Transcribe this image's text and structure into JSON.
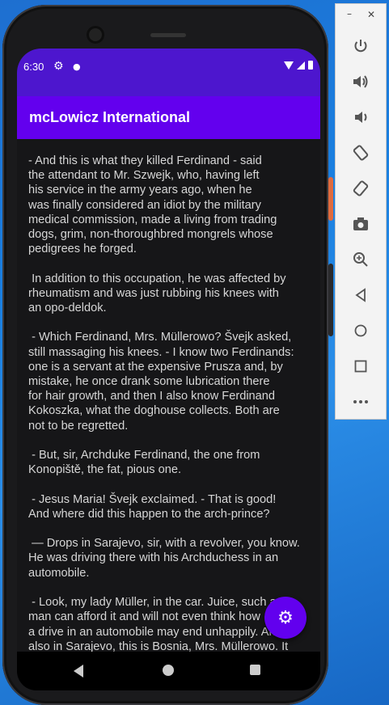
{
  "status_bar": {
    "time": "6:30"
  },
  "app_bar": {
    "title": "mcLowicz International"
  },
  "content": {
    "text": "- And this is what they killed Ferdinand - said\nthe attendant to Mr. Szwejk, who, having left\nhis service in the army years ago, when he\nwas finally considered an idiot by the military\nmedical commission, made a living from trading\ndogs, grim, non-thoroughbred mongrels whose\npedigrees he forged.\n\n In addition to this occupation, he was affected by\nrheumatism and was just rubbing his knees with\nan opo-deldok.\n\n - Which Ferdinand, Mrs. Müllerowo? Švejk asked,\nstill massaging his knees. - I know two Ferdinands:\none is a servant at the expensive Prusza and, by\nmistake, he once drank some lubrication there\nfor hair growth, and then I also know Ferdinand\nKokoszka, what the doghouse collects. Both are\nnot to be regretted.\n\n - But, sir, Archduke Ferdinand, the one from\nKonopiště, the fat, pious one.\n\n - Jesus Maria! Švejk exclaimed. - That is good!\nAnd where did this happen to the arch-prince?\n\n — Drops in Sarajevo, sir, with a revolver, you know.\nHe was driving there with his Archduchess in an\nautomobile.\n\n - Look, my lady Müller, in the car. Juice, such a\nman can afford it and will not even think how\na drive in an automobile may end unhappily. And\nalso in Sarajevo, this is Bosnia, Mrs. Müllerowo. It"
  },
  "icons": {
    "status_settings": "gear-icon",
    "fab": "settings-gear-icon",
    "panel": [
      "power-icon",
      "volume-up-icon",
      "volume-down-icon",
      "rotate-left-icon",
      "rotate-right-icon",
      "camera-icon",
      "zoom-icon",
      "back-icon",
      "home-icon",
      "overview-icon",
      "more-icon"
    ]
  },
  "colors": {
    "status_bar": "#4d16ce",
    "app_bar": "#6300ee",
    "fab": "#6200ee",
    "background": "#161618",
    "text": "#d6d6d6"
  }
}
